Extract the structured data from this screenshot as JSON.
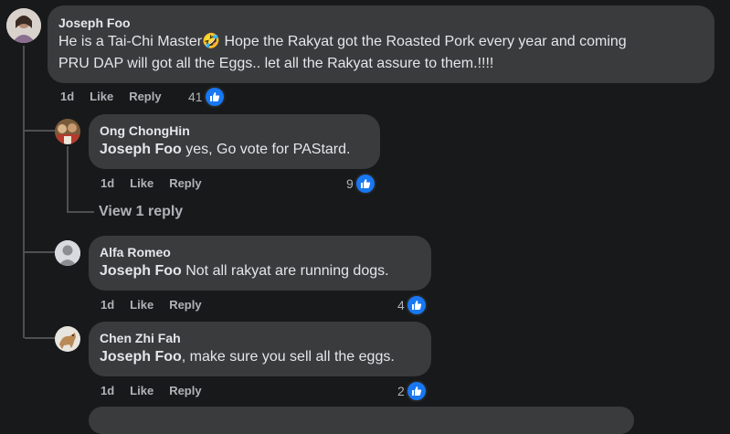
{
  "comments": {
    "main": {
      "author": "Joseph Foo",
      "text_line1": "He is a Tai-Chi Master",
      "emoji": "🤣",
      "text_line1b": " Hope the Rakyat got the Roasted Pork every year and coming",
      "text_line2": "PRU DAP will got all the Eggs.. let all the Rakyat assure to them.!!!!",
      "time": "1d",
      "like_label": "Like",
      "reply_label": "Reply",
      "reactions": "41",
      "avatar_icon": "woman-portrait-avatar"
    },
    "reply1": {
      "author": "Ong ChongHin",
      "mention": "Joseph Foo",
      "text": " yes, Go vote for PAStard.",
      "time": "1d",
      "like_label": "Like",
      "reply_label": "Reply",
      "reactions": "9",
      "view_replies": "View 1 reply"
    },
    "reply2": {
      "author": "Alfa Romeo",
      "mention": "Joseph Foo",
      "text": " Not all rakyat are running dogs.",
      "time": "1d",
      "like_label": "Like",
      "reply_label": "Reply",
      "reactions": "4"
    },
    "reply3": {
      "author": "Chen Zhi Fah",
      "mention": "Joseph Foo",
      "text": ", make sure you sell all the eggs.",
      "time": "1d",
      "like_label": "Like",
      "reply_label": "Reply",
      "reactions": "2"
    }
  },
  "colors": {
    "background": "#18191a",
    "bubble": "#3a3b3c",
    "like_blue": "#1877f2",
    "secondary_text": "#b0b3b8"
  }
}
